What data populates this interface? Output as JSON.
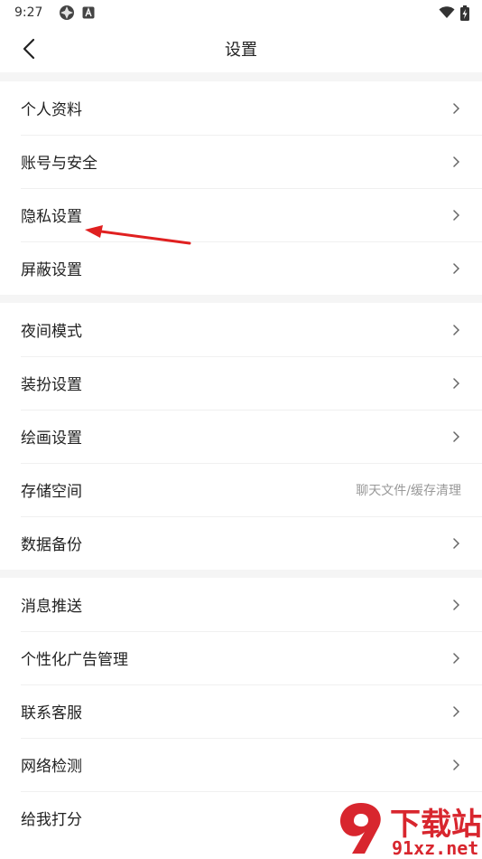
{
  "status_bar": {
    "time": "9:27"
  },
  "header": {
    "title": "设置"
  },
  "groups": [
    {
      "items": [
        {
          "label": "个人资料"
        },
        {
          "label": "账号与安全"
        },
        {
          "label": "隐私设置"
        },
        {
          "label": "屏蔽设置"
        }
      ]
    },
    {
      "items": [
        {
          "label": "夜间模式"
        },
        {
          "label": "装扮设置"
        },
        {
          "label": "绘画设置"
        },
        {
          "label": "存储空间",
          "hint": "聊天文件/缓存清理"
        },
        {
          "label": "数据备份"
        }
      ]
    },
    {
      "items": [
        {
          "label": "消息推送"
        },
        {
          "label": "个性化广告管理"
        },
        {
          "label": "联系客服"
        },
        {
          "label": "网络检测"
        },
        {
          "label": "给我打分"
        }
      ]
    }
  ],
  "watermark": {
    "line1": "下载站",
    "line2": "91xz.net"
  },
  "colors": {
    "annotation_arrow": "#e02020",
    "watermark": "#d8262e",
    "divider": "#f5f5f5"
  }
}
